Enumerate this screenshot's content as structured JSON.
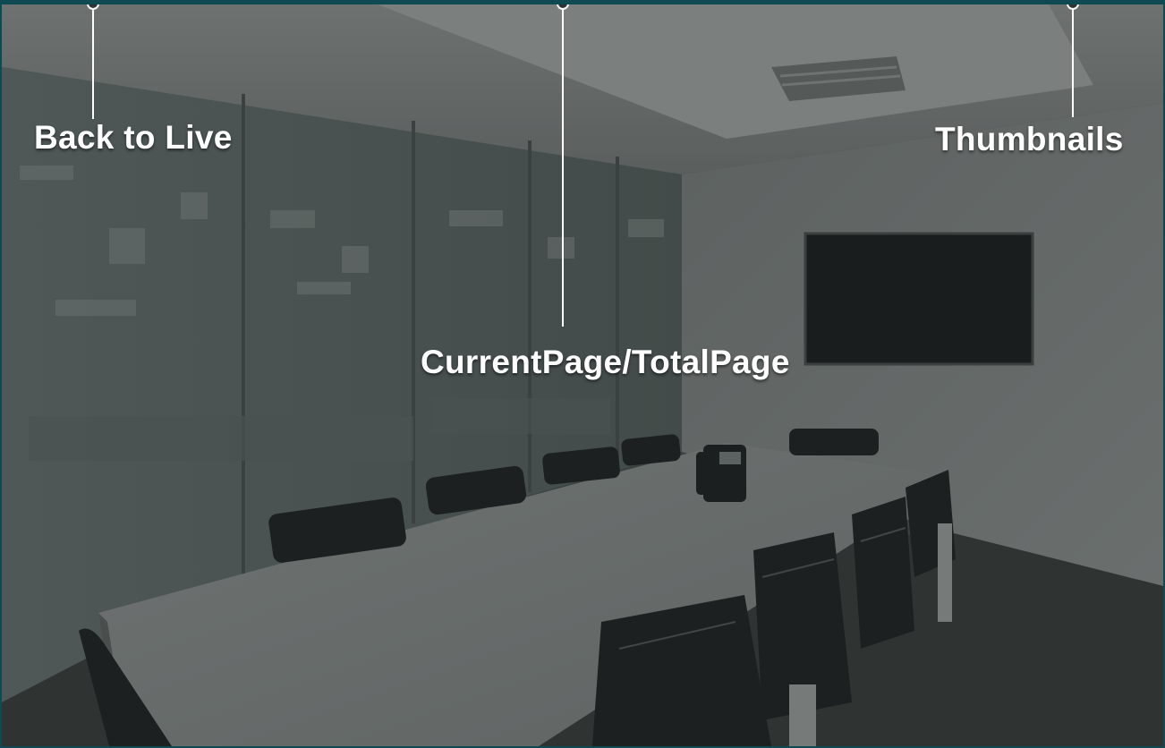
{
  "overlay": {
    "back_to_live_label": "Back to Live",
    "page_indicator_label": "CurrentPage/TotalPage",
    "thumbnails_label": "Thumbnails"
  },
  "colors": {
    "frame_border": "#0f4a52",
    "callout_line": "#ffffff",
    "label_text": "#ffffff"
  }
}
